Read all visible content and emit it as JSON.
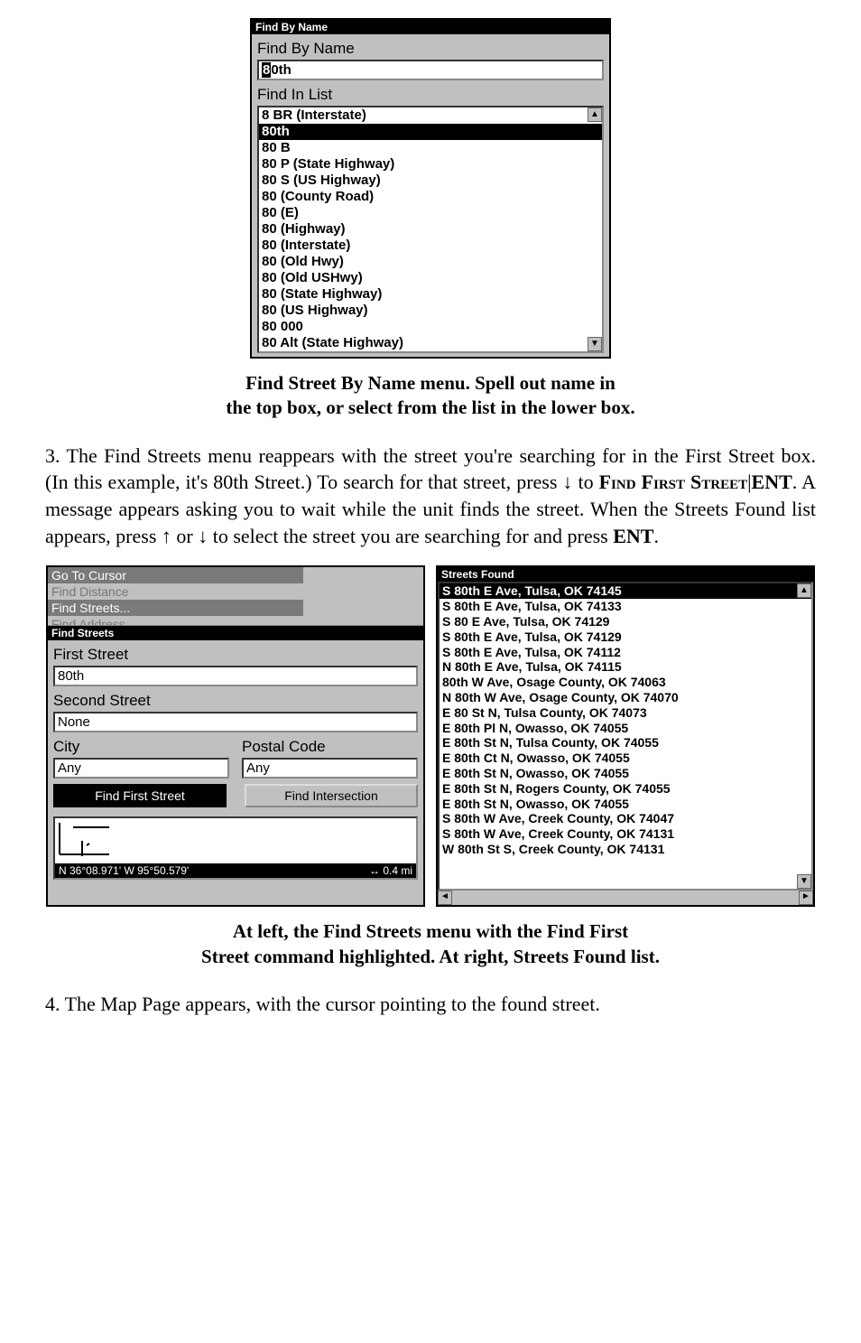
{
  "find_by_name_panel": {
    "title": "Find By Name",
    "name_label": "Find By Name",
    "name_input_prefix": "8",
    "name_input_rest": "0th",
    "list_label": "Find In List",
    "items": [
      "8 BR (Interstate)",
      "80th",
      "80  B",
      "80  P (State Highway)",
      "80  S (US Highway)",
      "80 (County Road)",
      "80 (E)",
      "80 (Highway)",
      "80 (Interstate)",
      "80 (Old Hwy)",
      "80 (Old USHwy)",
      "80 (State Highway)",
      "80 (US Highway)",
      "80 000",
      "80 Alt (State Highway)"
    ],
    "selected_index": 1
  },
  "caption1_line1": "Find Street By Name menu. Spell out name in",
  "caption1_line2": "the top box, or select from the list in the lower box.",
  "para3": "3. The Find Streets menu reappears with the street you're searching for in the First Street box. (In this example, it's 80th Street.) To search for that street, press ↓ to ",
  "para3_cmd1": "Find First Street",
  "para3_mid": "|",
  "para3_cmd2": "ENT",
  "para3_after": ". A message appears asking you to wait while the unit finds the street. When the Streets Found list appears, press ↑ or ↓ to select the street you are searching for and press ",
  "para3_cmd3": "ENT",
  "para3_end": ".",
  "find_streets_panel": {
    "ghost_items": [
      "Go To Cursor",
      "Find Distance",
      "Find Streets...",
      "Find Address..."
    ],
    "title": "Find Streets",
    "first_label": "First Street",
    "first_value": "80th",
    "second_label": "Second Street",
    "second_value": "None",
    "city_label": "City",
    "city_value": "Any",
    "postal_label": "Postal Code",
    "postal_value": "Any",
    "btn_find_first": "Find First Street",
    "btn_find_intersection": "Find Intersection",
    "status_left": "N    36°08.971'    W    95°50.579'",
    "status_right": "↔    0.4 mi"
  },
  "streets_found_panel": {
    "title": "Streets Found",
    "items": [
      "S 80th E Ave, Tulsa, OK 74145",
      "S 80th E Ave, Tulsa, OK 74133",
      "S 80 E Ave, Tulsa, OK 74129",
      "S 80th E Ave, Tulsa, OK 74129",
      "S 80th E Ave, Tulsa, OK 74112",
      "N 80th E Ave, Tulsa, OK 74115",
      "80th W Ave, Osage County, OK 74063",
      "N 80th W Ave, Osage County, OK 74070",
      "E 80 St N, Tulsa County, OK 74073",
      "E 80th Pl N, Owasso, OK 74055",
      "E 80th St N, Tulsa County, OK 74055",
      "E 80th Ct N, Owasso, OK 74055",
      "E 80th St N, Owasso, OK 74055",
      "E 80th St N, Rogers County, OK 74055",
      "E 80th St N, Owasso, OK 74055",
      "S 80th W Ave, Creek County, OK 74047",
      "S 80th W Ave, Creek County, OK 74131",
      "W 80th St S, Creek County, OK 74131"
    ],
    "selected_index": 0
  },
  "caption2_line1": "At left, the Find Streets menu with the Find First",
  "caption2_line2": "Street command highlighted. At right, Streets Found list.",
  "para4": "4. The Map Page appears, with the cursor pointing to the found street."
}
